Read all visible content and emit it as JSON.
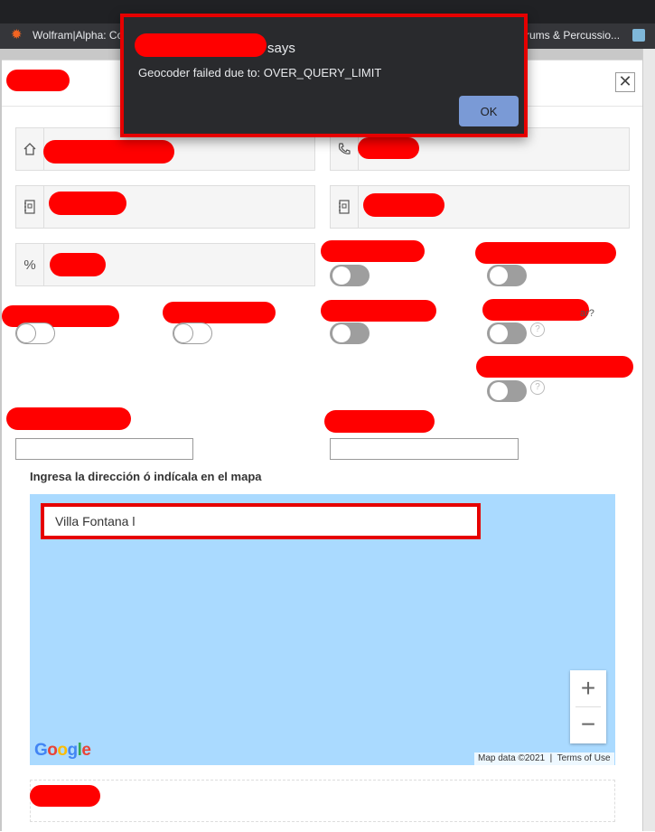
{
  "browser": {
    "bookmarks": [
      {
        "label": "Wolfram|Alpha: Co",
        "icon": "wolfram-sun-icon"
      },
      {
        "label": "rums & Percussio...",
        "icon": "none"
      }
    ]
  },
  "alert": {
    "says_text": "says",
    "message": "Geocoder failed due to: OVER_QUERY_LIMIT",
    "ok_label": "OK"
  },
  "modal": {
    "close_glyph": "✕"
  },
  "fields": {
    "row1_left_icon": "home-icon",
    "row1_right_icon": "phone-icon",
    "row2_left_icon": "address-book-icon",
    "row2_right_icon": "address-book-icon",
    "row3_left_icon": "percent-icon",
    "row3_left_glyph": "%"
  },
  "toggles": {
    "help_glyph": "?",
    "partial_text": "ar?"
  },
  "map": {
    "label": "Ingresa la dirección ó indícala en el mapa",
    "search_value": "Villa Fontana l",
    "zoom_in": "+",
    "zoom_out": "−",
    "logo": "Google",
    "map_data": "Map data ©2021",
    "terms": "Terms of Use"
  },
  "colors": {
    "redaction": "#ff0000",
    "alert_bg": "#292a2d",
    "ok_button": "#7a9ad6",
    "map_water": "#aadaff"
  }
}
